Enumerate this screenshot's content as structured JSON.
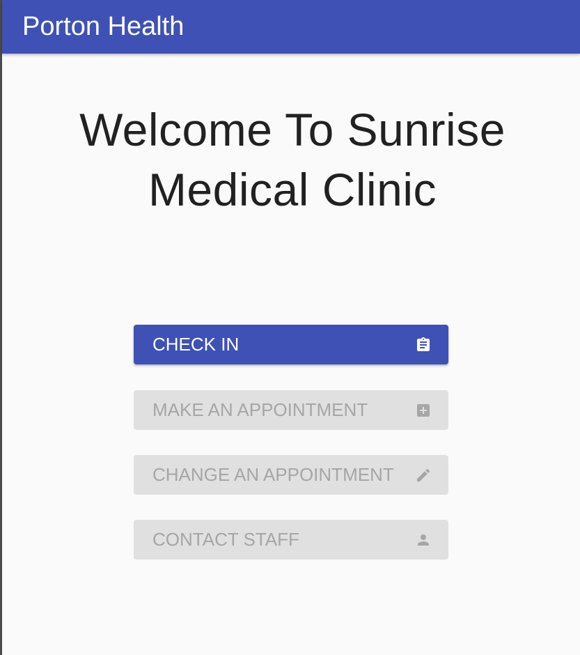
{
  "app_bar": {
    "title": "Porton Health",
    "color": "#3f51b5"
  },
  "welcome": {
    "line1": "Welcome To Sunrise",
    "line2": "Medical Clinic"
  },
  "actions": [
    {
      "label": "CHECK IN",
      "icon": "clipboard-icon",
      "enabled": true
    },
    {
      "label": "MAKE AN APPOINTMENT",
      "icon": "plus-box-icon",
      "enabled": false
    },
    {
      "label": "CHANGE AN APPOINTMENT",
      "icon": "pencil-icon",
      "enabled": false
    },
    {
      "label": "CONTACT STAFF",
      "icon": "person-icon",
      "enabled": false
    }
  ],
  "colors": {
    "primary": "#3f51b5",
    "disabled_bg": "#e0e0e0",
    "disabled_text": "#a6a6a6",
    "background": "#fafafa"
  }
}
